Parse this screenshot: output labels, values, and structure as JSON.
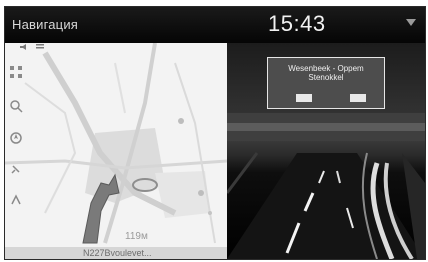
{
  "header": {
    "title": "Навигация",
    "time": "15:43",
    "signal_icon": "signal-icon"
  },
  "map": {
    "distance": "119м",
    "street": "N227Bvoulevet...",
    "controls": [
      "grid-icon",
      "zoom-icon",
      "compass-icon",
      "poi-icon",
      "route-icon"
    ]
  },
  "camera": {
    "sign": {
      "line1": "Wesenbeek - Oppem",
      "line2": "Stenokkel"
    }
  },
  "colors": {
    "map_background": "#f4f4f4",
    "screen_background": "#0b0b0b",
    "sign_background": "#4d4d4d"
  }
}
